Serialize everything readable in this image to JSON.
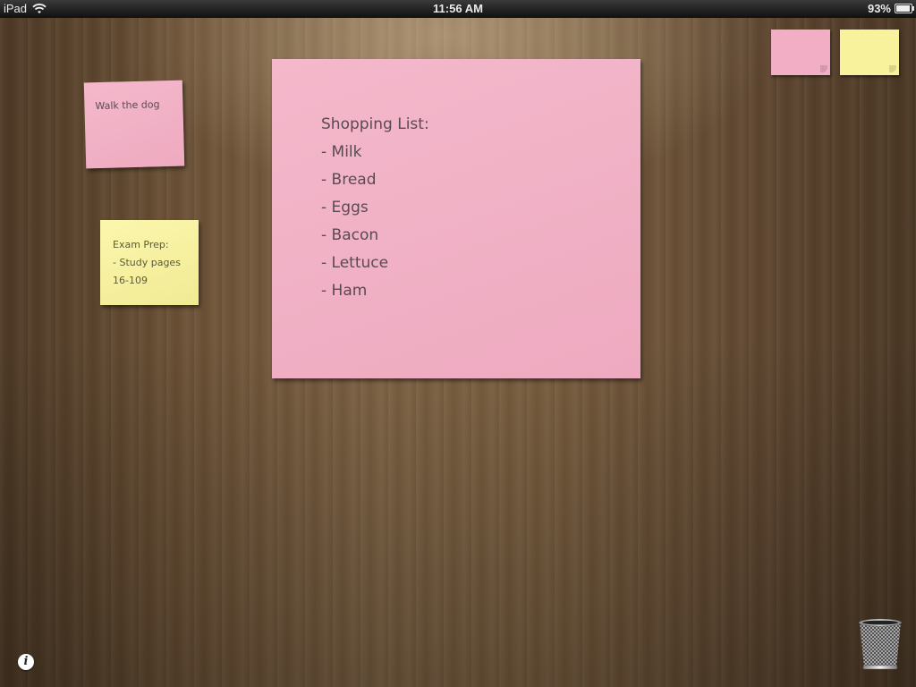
{
  "status_bar": {
    "device": "iPad",
    "time": "11:56 AM",
    "battery_percent": "93%",
    "battery_level": 0.93
  },
  "notes": {
    "walk": {
      "color": "#f2b3c7",
      "lines": [
        "Walk the dog"
      ]
    },
    "exam": {
      "color": "#f6f0a2",
      "lines": [
        "Exam Prep:",
        "- Study pages",
        "16-109"
      ]
    },
    "shopping": {
      "color": "#f2b3c7",
      "lines": [
        "Shopping List:",
        "- Milk",
        "- Bread",
        "- Eggs",
        "- Bacon",
        "- Lettuce",
        "- Ham"
      ]
    }
  },
  "palette": {
    "pink": "#f2aec4",
    "yellow": "#f7f29b"
  },
  "icons": {
    "info": "i",
    "trash": "trash-can-icon",
    "wifi": "wifi-icon",
    "battery": "battery-icon"
  }
}
